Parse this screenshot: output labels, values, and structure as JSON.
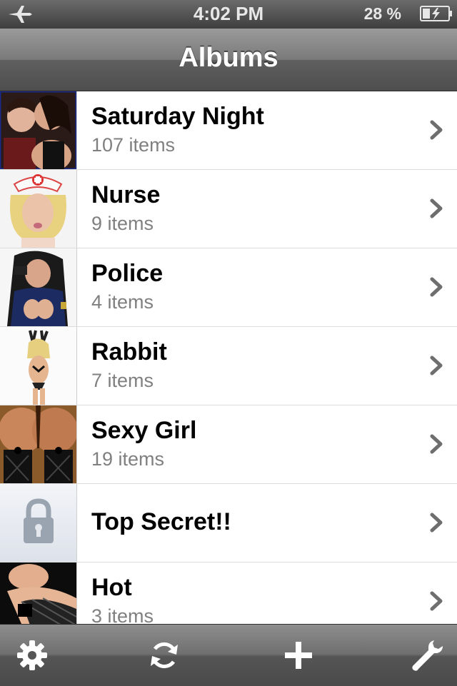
{
  "status_bar": {
    "time": "4:02 PM",
    "battery": "28 %"
  },
  "nav": {
    "title": "Albums"
  },
  "albums": [
    {
      "title": "Saturday Night",
      "count": "107 items"
    },
    {
      "title": "Nurse",
      "count": "9 items"
    },
    {
      "title": "Police",
      "count": "4 items"
    },
    {
      "title": "Rabbit",
      "count": "7 items"
    },
    {
      "title": "Sexy Girl",
      "count": "19 items"
    },
    {
      "title": "Top Secret!!",
      "count": ""
    },
    {
      "title": "Hot",
      "count": "3 items"
    }
  ],
  "toolbar": {
    "settings_icon": "gear-icon",
    "sync_icon": "refresh-icon",
    "add_icon": "plus-icon",
    "tools_icon": "wrench-icon"
  },
  "colors": {
    "chevron": "#6e6e6e",
    "count_text": "#808080",
    "lock": "#9aa3b0"
  }
}
